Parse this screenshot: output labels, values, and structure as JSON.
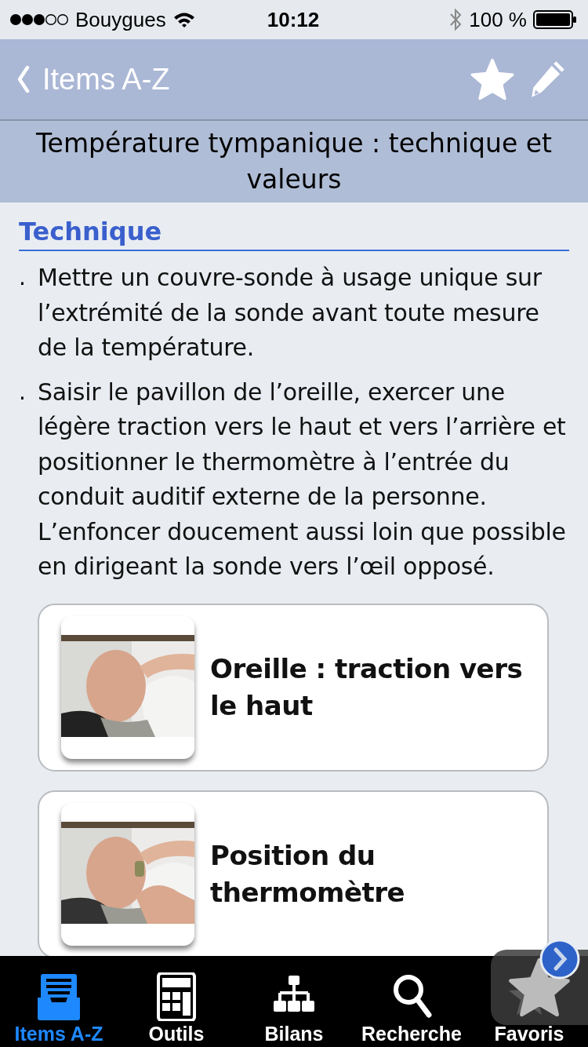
{
  "status_bar": {
    "carrier": "Bouygues",
    "time": "10:12",
    "battery": "100 %"
  },
  "nav_bar": {
    "back_label": "Items A-Z"
  },
  "page_title": "Température tympanique : technique et valeurs",
  "section": {
    "heading": "Technique",
    "bullets": [
      {
        "marker": ".",
        "text": "Mettre un couvre-sonde à usage unique sur l’extrémité de la sonde avant toute mesure de la température."
      },
      {
        "marker": ".",
        "text": "Saisir le pavillon de l’oreille, exercer une légère traction vers le haut et vers l’arrière et positionner le thermomètre à l’entrée du conduit auditif externe de la personne. L’enfoncer doucement aussi loin que possible en dirigeant la sonde vers l’œil opposé."
      }
    ],
    "cards": [
      {
        "kind": "picture",
        "caption": "Oreille : traction vers le haut"
      },
      {
        "kind": "picture",
        "caption": "Position du thermomètre"
      }
    ]
  },
  "tab_bar": [
    {
      "kind": "tray",
      "label": "Items A-Z",
      "selected": true
    },
    {
      "kind": "calculator",
      "label": "Outils",
      "selected": false
    },
    {
      "kind": "hierarchy",
      "label": "Bilans",
      "selected": false
    },
    {
      "kind": "search",
      "label": "Recherche",
      "selected": false
    },
    {
      "kind": "star",
      "label": "Favoris",
      "selected": false
    }
  ]
}
